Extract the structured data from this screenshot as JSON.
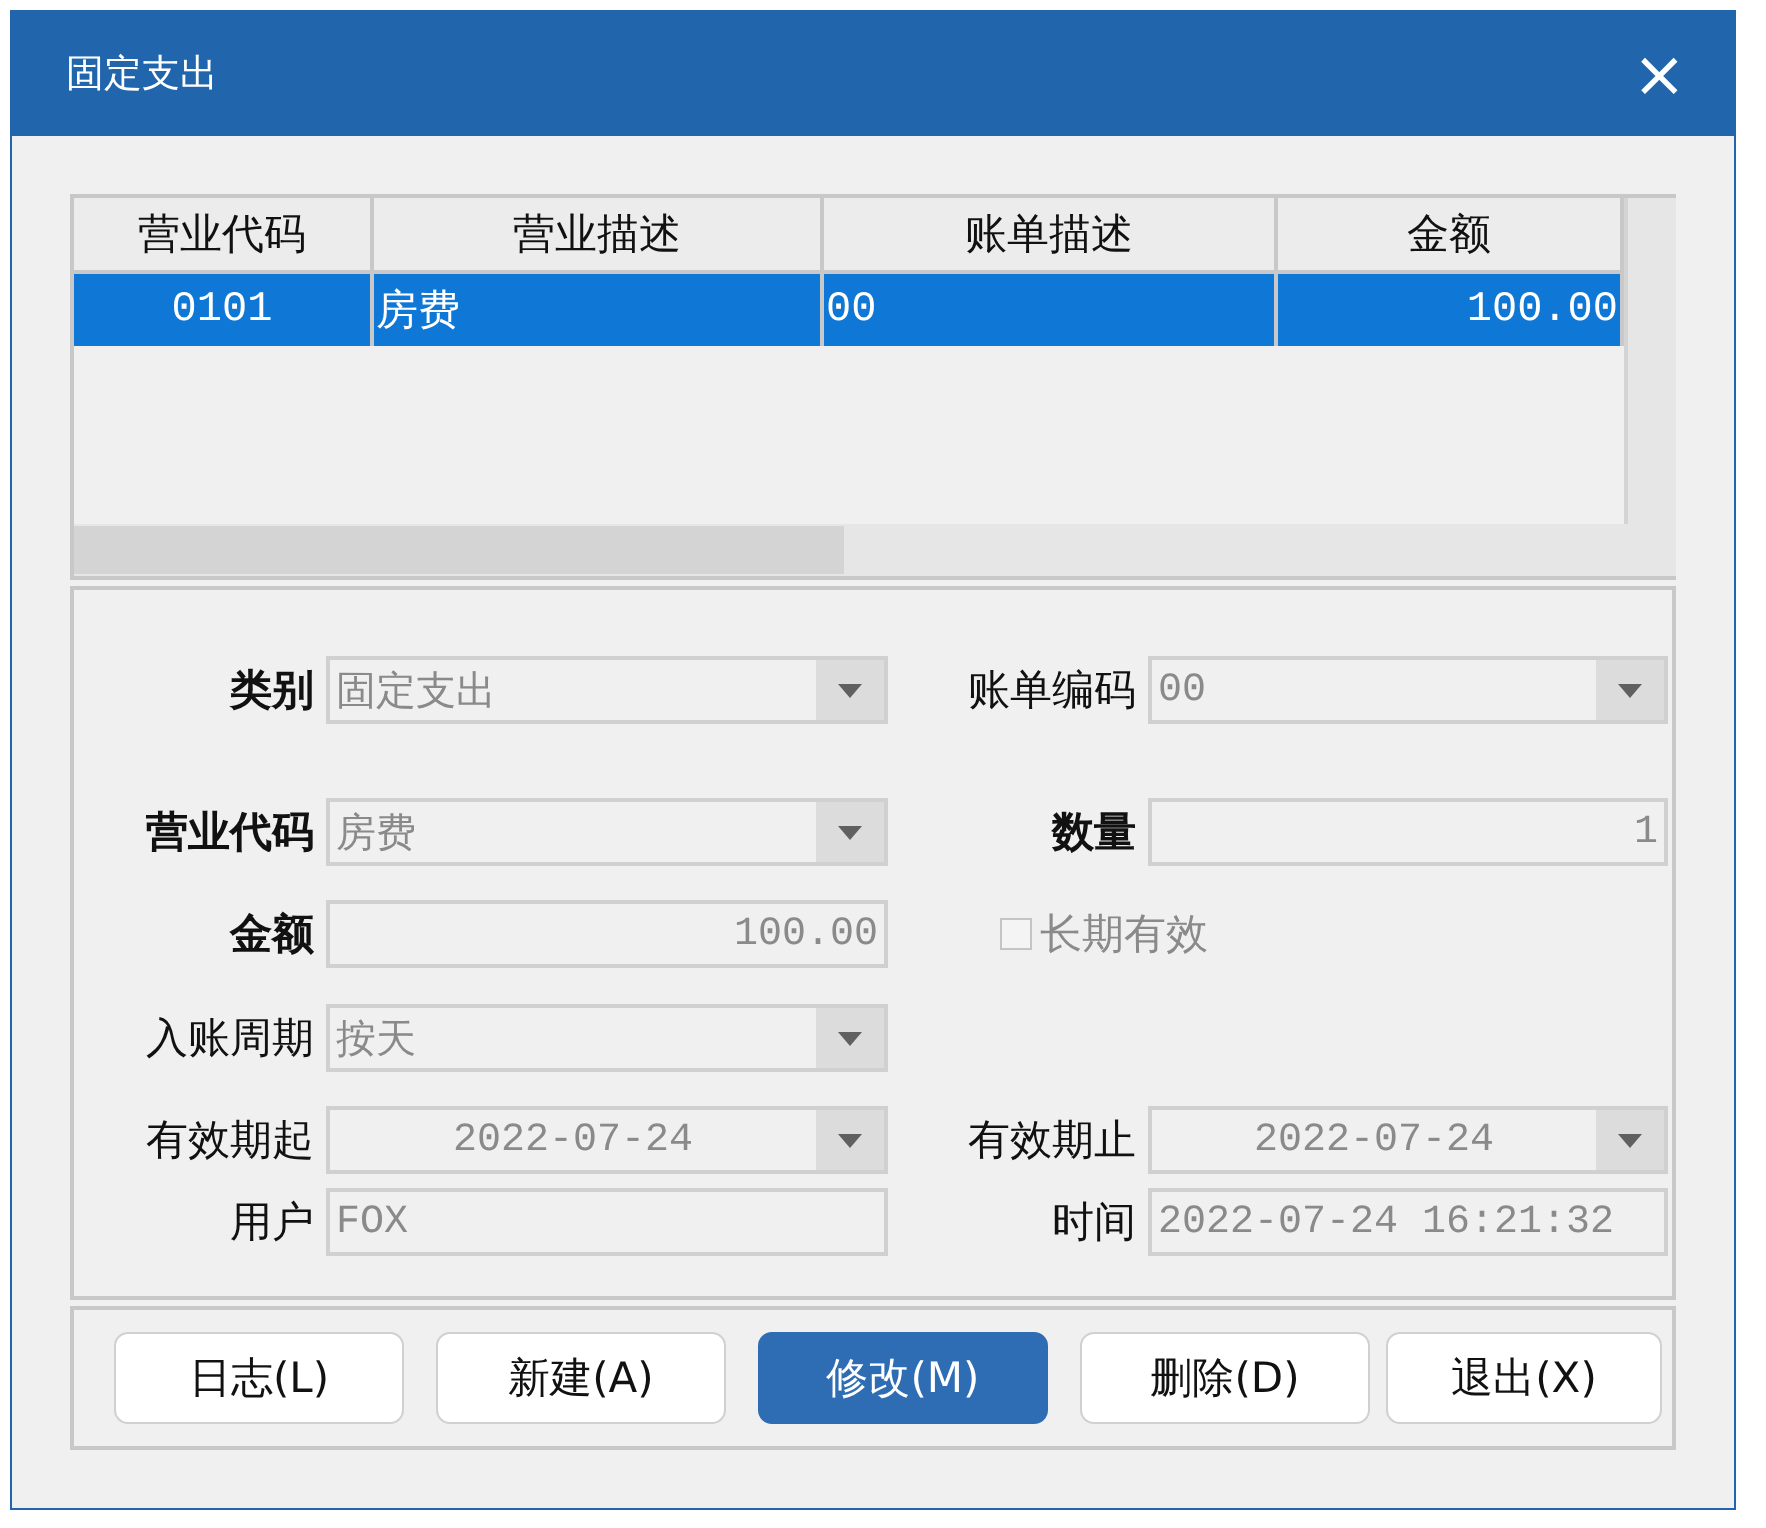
{
  "window": {
    "title": "固定支出",
    "close": "×"
  },
  "table": {
    "columns": [
      "营业代码",
      "营业描述",
      "账单描述",
      "金额"
    ],
    "rows": [
      {
        "selected": true,
        "cells": [
          "0101",
          "房费",
          "00",
          "100.00"
        ]
      }
    ]
  },
  "form": {
    "rows": [
      {
        "left": {
          "label": "类别",
          "bold": true,
          "kind": "select",
          "value": "固定支出",
          "disabled": true
        },
        "right": {
          "label": "账单编码",
          "bold": false,
          "kind": "select",
          "value": "00",
          "disabled": true
        }
      },
      {
        "left": {
          "label": "营业代码",
          "bold": true,
          "kind": "select",
          "value": "房费",
          "disabled": true
        },
        "right": {
          "label": "数量",
          "bold": true,
          "kind": "number",
          "value": "1",
          "disabled": true
        }
      },
      {
        "left": {
          "label": "金额",
          "bold": true,
          "kind": "number",
          "value": "100.00",
          "disabled": true
        },
        "right": {
          "kind": "checkbox",
          "label": "长期有效",
          "checked": false,
          "disabled": true
        }
      },
      {
        "left": {
          "label": "入账周期",
          "bold": false,
          "kind": "select",
          "value": "按天",
          "disabled": true
        }
      },
      {
        "left": {
          "label": "有效期起",
          "bold": false,
          "kind": "date",
          "value": "2022-07-24",
          "disabled": true
        },
        "right": {
          "label": "有效期止",
          "bold": false,
          "kind": "date",
          "value": "2022-07-24",
          "disabled": true
        }
      },
      {
        "left": {
          "label": "用户",
          "bold": false,
          "kind": "text",
          "value": "FOX",
          "disabled": true
        },
        "right": {
          "label": "时间",
          "bold": false,
          "kind": "text",
          "value": "2022-07-24 16:21:32",
          "disabled": true
        }
      }
    ]
  },
  "buttons": [
    {
      "label": "日志(L)",
      "selected": false
    },
    {
      "label": "新建(A)",
      "selected": false
    },
    {
      "label": "修改(M)",
      "selected": true
    },
    {
      "label": "删除(D)",
      "selected": false
    },
    {
      "label": "退出(X)",
      "selected": false
    }
  ]
}
